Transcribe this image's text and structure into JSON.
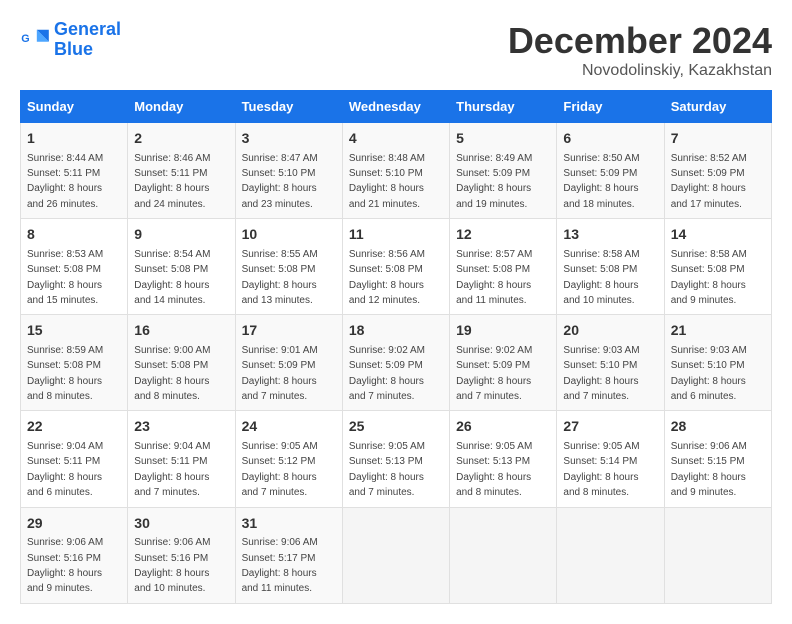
{
  "header": {
    "logo_line1": "General",
    "logo_line2": "Blue",
    "month": "December 2024",
    "location": "Novodolinskiy, Kazakhstan"
  },
  "weekdays": [
    "Sunday",
    "Monday",
    "Tuesday",
    "Wednesday",
    "Thursday",
    "Friday",
    "Saturday"
  ],
  "weeks": [
    [
      {
        "day": "1",
        "info": "Sunrise: 8:44 AM\nSunset: 5:11 PM\nDaylight: 8 hours\nand 26 minutes."
      },
      {
        "day": "2",
        "info": "Sunrise: 8:46 AM\nSunset: 5:11 PM\nDaylight: 8 hours\nand 24 minutes."
      },
      {
        "day": "3",
        "info": "Sunrise: 8:47 AM\nSunset: 5:10 PM\nDaylight: 8 hours\nand 23 minutes."
      },
      {
        "day": "4",
        "info": "Sunrise: 8:48 AM\nSunset: 5:10 PM\nDaylight: 8 hours\nand 21 minutes."
      },
      {
        "day": "5",
        "info": "Sunrise: 8:49 AM\nSunset: 5:09 PM\nDaylight: 8 hours\nand 19 minutes."
      },
      {
        "day": "6",
        "info": "Sunrise: 8:50 AM\nSunset: 5:09 PM\nDaylight: 8 hours\nand 18 minutes."
      },
      {
        "day": "7",
        "info": "Sunrise: 8:52 AM\nSunset: 5:09 PM\nDaylight: 8 hours\nand 17 minutes."
      }
    ],
    [
      {
        "day": "8",
        "info": "Sunrise: 8:53 AM\nSunset: 5:08 PM\nDaylight: 8 hours\nand 15 minutes."
      },
      {
        "day": "9",
        "info": "Sunrise: 8:54 AM\nSunset: 5:08 PM\nDaylight: 8 hours\nand 14 minutes."
      },
      {
        "day": "10",
        "info": "Sunrise: 8:55 AM\nSunset: 5:08 PM\nDaylight: 8 hours\nand 13 minutes."
      },
      {
        "day": "11",
        "info": "Sunrise: 8:56 AM\nSunset: 5:08 PM\nDaylight: 8 hours\nand 12 minutes."
      },
      {
        "day": "12",
        "info": "Sunrise: 8:57 AM\nSunset: 5:08 PM\nDaylight: 8 hours\nand 11 minutes."
      },
      {
        "day": "13",
        "info": "Sunrise: 8:58 AM\nSunset: 5:08 PM\nDaylight: 8 hours\nand 10 minutes."
      },
      {
        "day": "14",
        "info": "Sunrise: 8:58 AM\nSunset: 5:08 PM\nDaylight: 8 hours\nand 9 minutes."
      }
    ],
    [
      {
        "day": "15",
        "info": "Sunrise: 8:59 AM\nSunset: 5:08 PM\nDaylight: 8 hours\nand 8 minutes."
      },
      {
        "day": "16",
        "info": "Sunrise: 9:00 AM\nSunset: 5:08 PM\nDaylight: 8 hours\nand 8 minutes."
      },
      {
        "day": "17",
        "info": "Sunrise: 9:01 AM\nSunset: 5:09 PM\nDaylight: 8 hours\nand 7 minutes."
      },
      {
        "day": "18",
        "info": "Sunrise: 9:02 AM\nSunset: 5:09 PM\nDaylight: 8 hours\nand 7 minutes."
      },
      {
        "day": "19",
        "info": "Sunrise: 9:02 AM\nSunset: 5:09 PM\nDaylight: 8 hours\nand 7 minutes."
      },
      {
        "day": "20",
        "info": "Sunrise: 9:03 AM\nSunset: 5:10 PM\nDaylight: 8 hours\nand 7 minutes."
      },
      {
        "day": "21",
        "info": "Sunrise: 9:03 AM\nSunset: 5:10 PM\nDaylight: 8 hours\nand 6 minutes."
      }
    ],
    [
      {
        "day": "22",
        "info": "Sunrise: 9:04 AM\nSunset: 5:11 PM\nDaylight: 8 hours\nand 6 minutes."
      },
      {
        "day": "23",
        "info": "Sunrise: 9:04 AM\nSunset: 5:11 PM\nDaylight: 8 hours\nand 7 minutes."
      },
      {
        "day": "24",
        "info": "Sunrise: 9:05 AM\nSunset: 5:12 PM\nDaylight: 8 hours\nand 7 minutes."
      },
      {
        "day": "25",
        "info": "Sunrise: 9:05 AM\nSunset: 5:13 PM\nDaylight: 8 hours\nand 7 minutes."
      },
      {
        "day": "26",
        "info": "Sunrise: 9:05 AM\nSunset: 5:13 PM\nDaylight: 8 hours\nand 8 minutes."
      },
      {
        "day": "27",
        "info": "Sunrise: 9:05 AM\nSunset: 5:14 PM\nDaylight: 8 hours\nand 8 minutes."
      },
      {
        "day": "28",
        "info": "Sunrise: 9:06 AM\nSunset: 5:15 PM\nDaylight: 8 hours\nand 9 minutes."
      }
    ],
    [
      {
        "day": "29",
        "info": "Sunrise: 9:06 AM\nSunset: 5:16 PM\nDaylight: 8 hours\nand 9 minutes."
      },
      {
        "day": "30",
        "info": "Sunrise: 9:06 AM\nSunset: 5:16 PM\nDaylight: 8 hours\nand 10 minutes."
      },
      {
        "day": "31",
        "info": "Sunrise: 9:06 AM\nSunset: 5:17 PM\nDaylight: 8 hours\nand 11 minutes."
      },
      null,
      null,
      null,
      null
    ]
  ]
}
